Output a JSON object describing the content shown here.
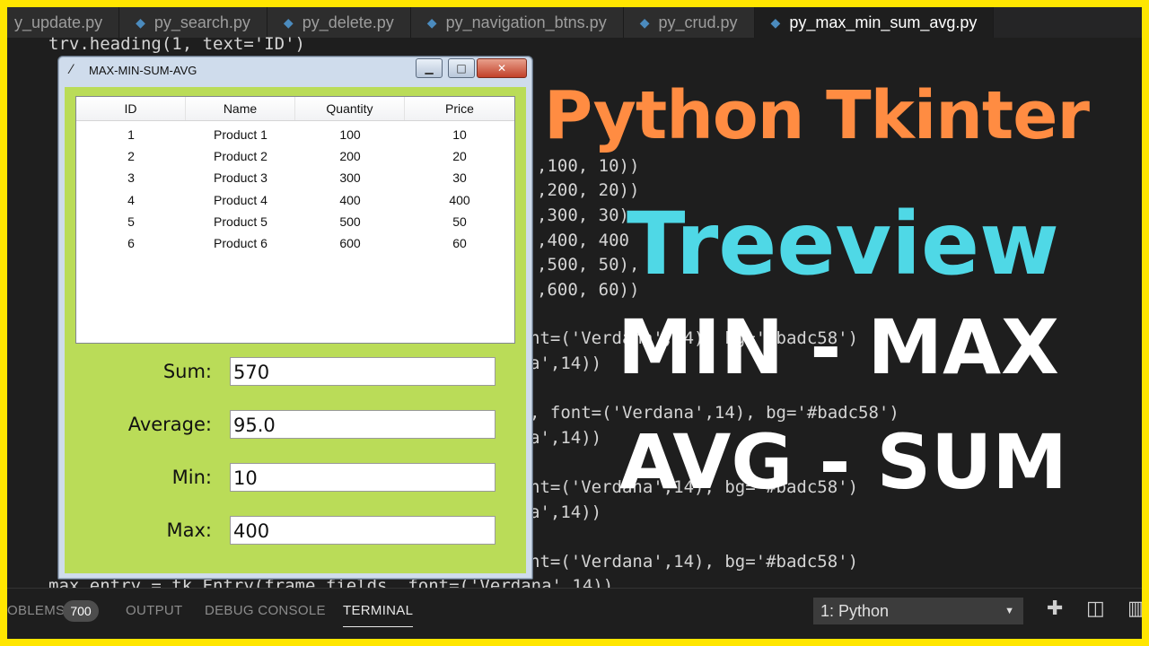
{
  "tabs": [
    {
      "label": "y_update.py",
      "active": false
    },
    {
      "label": "py_search.py",
      "active": false
    },
    {
      "label": "py_delete.py",
      "active": false
    },
    {
      "label": "py_navigation_btns.py",
      "active": false
    },
    {
      "label": "py_crud.py",
      "active": false
    },
    {
      "label": "py_max_min_sum_avg.py",
      "active": true
    }
  ],
  "code": {
    "top_line": "trv.heading(1, text='ID')",
    "insert_values": [
      ",100, 10))",
      ",200, 20))",
      ",300, 30)",
      ",400, 400",
      ",500, 50),",
      ",600, 60))"
    ],
    "sum_label_tail": "nt=('Verdana',14), bg='#badc58')",
    "sum_entry_tail": "a',14))",
    "avg_label_tail": ", font=('Verdana',14), bg='#badc58')",
    "avg_entry_tail": "a',14))",
    "min_label_tail": "nt=('Verdana',14), bg='#badc58')",
    "min_entry_tail": "a',14))",
    "max_label_tail": "nt=('Verdana',14), bg='#badc58')",
    "bottom_line": "max_entry = tk.Entry(frame_fields, font=('Verdana',14))"
  },
  "headline": {
    "line1": "Python Tkinter",
    "line2": "Treeview",
    "line3": "MIN - MAX",
    "line4": "AVG - SUM"
  },
  "window": {
    "title": "MAX-MIN-SUM-AVG",
    "columns": [
      "ID",
      "Name",
      "Quantity",
      "Price"
    ],
    "rows": [
      [
        "1",
        "Product 1",
        "100",
        "10"
      ],
      [
        "2",
        "Product 2",
        "200",
        "20"
      ],
      [
        "3",
        "Product 3",
        "300",
        "30"
      ],
      [
        "4",
        "Product 4",
        "400",
        "400"
      ],
      [
        "5",
        "Product 5",
        "500",
        "50"
      ],
      [
        "6",
        "Product 6",
        "600",
        "60"
      ]
    ],
    "fields": {
      "sum_label": "Sum:",
      "sum_value": "570",
      "avg_label": "Average:",
      "avg_value": "95.0",
      "min_label": "Min:",
      "min_value": "10",
      "max_label": "Max:",
      "max_value": "400"
    },
    "bg_color": "#badc58"
  },
  "panel": {
    "problems_label": "OBLEMS",
    "problems_count": "700",
    "output_label": "OUTPUT",
    "debug_label": "DEBUG CONSOLE",
    "terminal_label": "TERMINAL",
    "terminal_select": "1: Python"
  },
  "colors": {
    "border": "#ffe600",
    "title_orange": "#ff8c42",
    "title_cyan": "#4fd8e6"
  }
}
